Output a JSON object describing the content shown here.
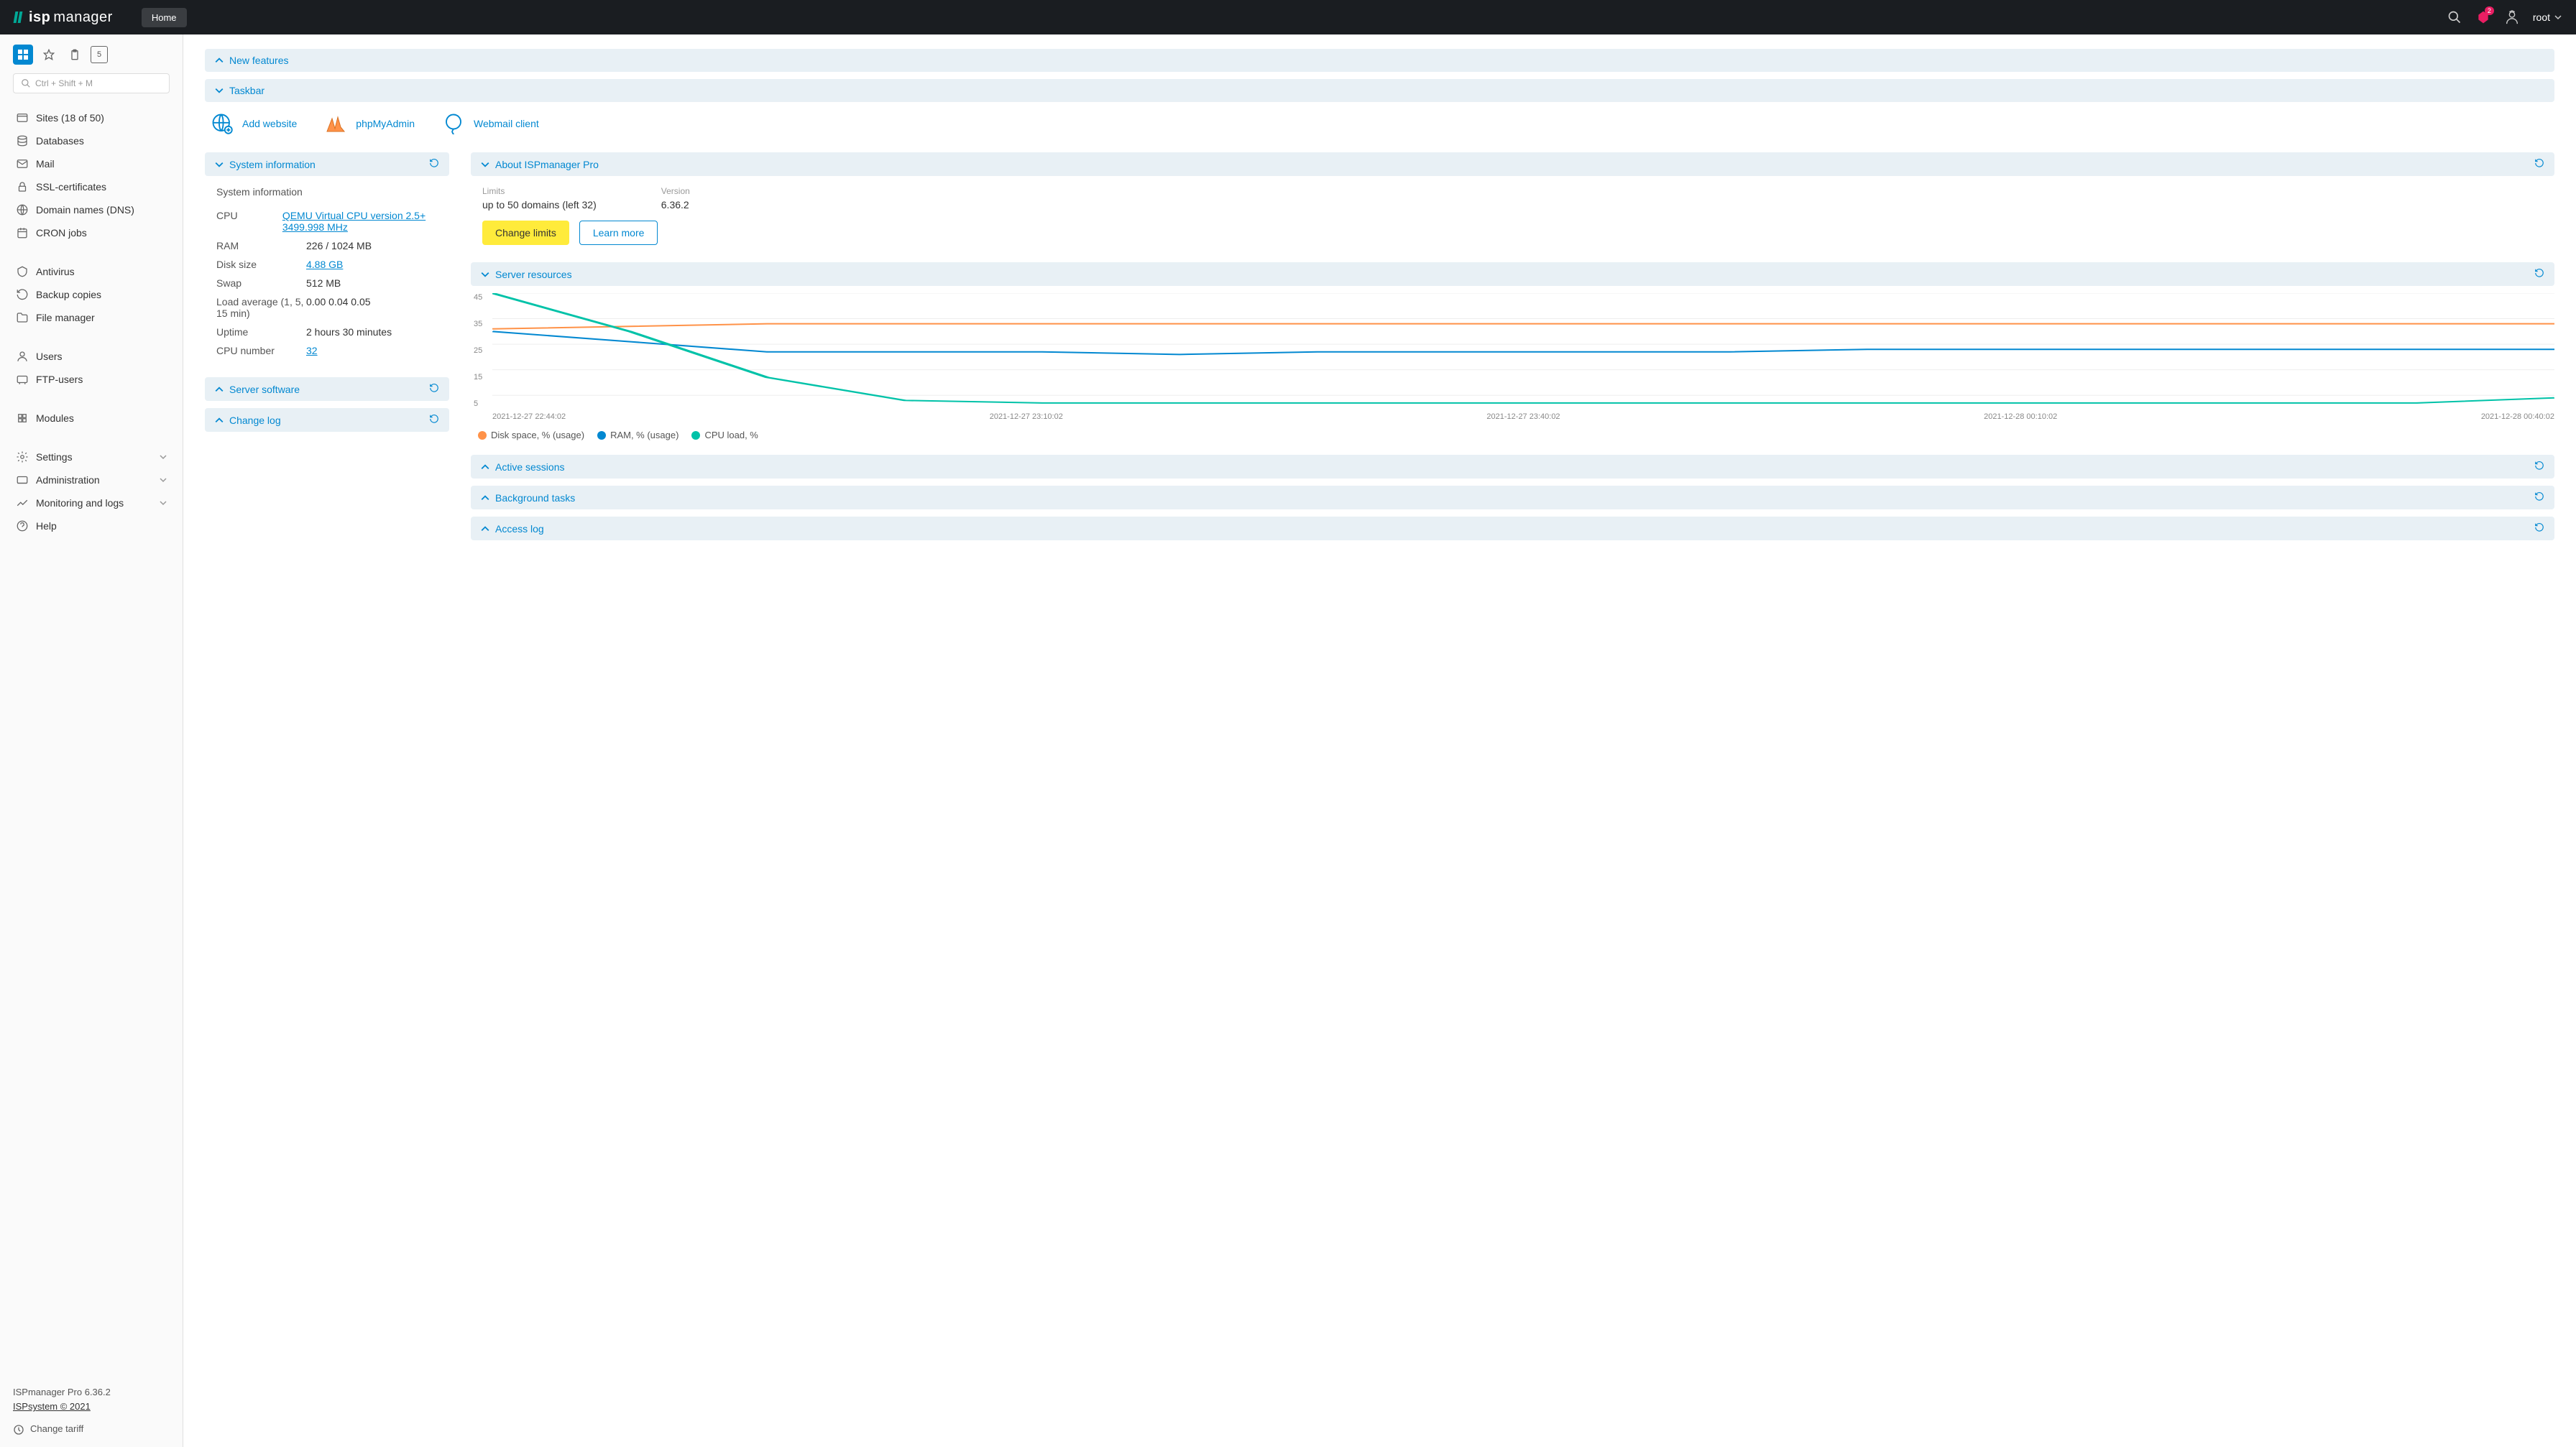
{
  "header": {
    "logo_prefix": "isp",
    "logo_suffix": "manager",
    "tab": "Home",
    "notif_count": "2",
    "username": "root"
  },
  "sidebar": {
    "search_placeholder": "Ctrl + Shift + M",
    "groups": [
      [
        "Sites (18 of 50)",
        "Databases",
        "Mail",
        "SSL-certificates",
        "Domain names (DNS)",
        "CRON jobs"
      ],
      [
        "Antivirus",
        "Backup copies",
        "File manager"
      ],
      [
        "Users",
        "FTP-users"
      ],
      [
        "Modules"
      ],
      [
        "Settings",
        "Administration",
        "Monitoring and logs",
        "Help"
      ]
    ],
    "expandable": [
      "Settings",
      "Administration",
      "Monitoring and logs"
    ],
    "icon_box_label": "5",
    "version": "ISPmanager Pro 6.36.2",
    "copyright": "ISPsystem © 2021",
    "tariff": "Change tariff"
  },
  "panels": {
    "new_features": "New features",
    "taskbar": "Taskbar",
    "sysinfo": "System information",
    "server_software": "Server software",
    "change_log": "Change log",
    "about": "About ISPmanager Pro",
    "server_resources": "Server resources",
    "active_sessions": "Active sessions",
    "background_tasks": "Background tasks",
    "access_log": "Access log"
  },
  "taskbar_items": [
    "Add website",
    "phpMyAdmin",
    "Webmail client"
  ],
  "sysinfo": {
    "subtitle": "System information",
    "rows": [
      {
        "label": "CPU",
        "value": "QEMU Virtual CPU version 2.5+ 3499.998 MHz",
        "link": true
      },
      {
        "label": "RAM",
        "value": "226 / 1024 MB",
        "link": false
      },
      {
        "label": "Disk size",
        "value": "4.88 GB",
        "link": true
      },
      {
        "label": "Swap",
        "value": "512 MB",
        "link": false
      },
      {
        "label": "Load average (1, 5, 15 min)",
        "value": "0.00 0.04 0.05",
        "link": false
      },
      {
        "label": "Uptime",
        "value": "2 hours 30 minutes",
        "link": false
      },
      {
        "label": "CPU number",
        "value": "32",
        "link": true
      }
    ]
  },
  "about": {
    "limits_label": "Limits",
    "limits_value": "up to 50 domains (left 32)",
    "version_label": "Version",
    "version_value": "6.36.2",
    "btn_change": "Change limits",
    "btn_learn": "Learn more"
  },
  "chart_data": {
    "type": "line",
    "ylim": [
      0,
      45
    ],
    "yticks": [
      5,
      15,
      25,
      35,
      45
    ],
    "x_labels": [
      "2021-12-27 22:44:02",
      "2021-12-27 23:10:02",
      "2021-12-27 23:40:02",
      "2021-12-28 00:10:02",
      "2021-12-28 00:40:02"
    ],
    "series": [
      {
        "name": "Disk space, % (usage)",
        "color": "#ff9248",
        "values": [
          31,
          32,
          33,
          33,
          33,
          33,
          33,
          33,
          33,
          33,
          33,
          33,
          33,
          33,
          33,
          33
        ]
      },
      {
        "name": "RAM, % (usage)",
        "color": "#0288d1",
        "values": [
          30,
          26,
          22,
          22,
          22,
          21,
          22,
          22,
          22,
          22,
          23,
          23,
          23,
          23,
          23,
          23
        ]
      },
      {
        "name": "CPU load, %",
        "color": "#00c2a8",
        "values": [
          45,
          30,
          12,
          3,
          2,
          2,
          2,
          2,
          2,
          2,
          2,
          2,
          2,
          2,
          2,
          4
        ]
      }
    ]
  }
}
